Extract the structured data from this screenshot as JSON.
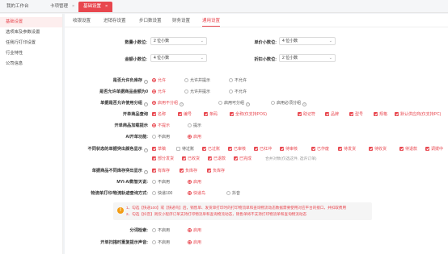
{
  "top_tabs": [
    {
      "label": "我的工作台",
      "closable": false
    },
    {
      "label": "卡项管理",
      "closable": true
    },
    {
      "label": "基础设置",
      "closable": true,
      "active": true
    }
  ],
  "sidebar": {
    "items": [
      {
        "label": "基础设置",
        "active": true
      },
      {
        "label": "选项库及参数设置"
      },
      {
        "label": "任我行打印设置"
      },
      {
        "label": "行业特性"
      },
      {
        "label": "公司信息"
      }
    ]
  },
  "subtabs": [
    {
      "label": "收银设置"
    },
    {
      "label": "进销存设置"
    },
    {
      "label": "步口数设置"
    },
    {
      "label": "财务设置"
    },
    {
      "label": "通用设置",
      "active": true
    }
  ],
  "decimals": {
    "qty_label": "数量小数位:",
    "qty_value": "2 位小数",
    "unit_price_label": "单价小数位:",
    "unit_price_value": "4 位小数",
    "amount_label": "金额小数位:",
    "amount_value": "4 位小数",
    "discount_label": "折扣小数位:",
    "discount_value": "2 位小数"
  },
  "settings": {
    "negative_stock": {
      "label": "是否允许负库存",
      "options": [
        "允许",
        "允许并提示",
        "不允许"
      ]
    },
    "price_zero": {
      "label": "是否允许单据商品金额为0",
      "options": [
        "允许",
        "允许并提示",
        "不允许"
      ]
    },
    "multi_unit": {
      "label": "单据是否允许使用分组",
      "options": [
        "启用不分组",
        "启用可分组",
        "启用必须分组"
      ]
    },
    "goods_fields": {
      "label": "开单商品查询",
      "options": [
        "名称",
        "编号",
        "条码",
        "全称(仅支持POS)",
        "助记符",
        "品牌",
        "型号",
        "规格",
        "默认供应商(仅支持PC)"
      ]
    },
    "tip_on_open": {
      "label": "开单商品加载提示",
      "options": [
        "不提示",
        "提示"
      ]
    },
    "ai_open": {
      "label": "AI开单功能:",
      "options": [
        "不启用",
        "启用"
      ]
    },
    "bill_status": {
      "label": "不同状态的单据突出颜色显示",
      "row1": [
        "草稿",
        "待过账",
        "已过账",
        "已审核",
        "已红冲",
        "待审核",
        "已作废",
        "待发货",
        "待收货",
        "待退款",
        "调拨中"
      ],
      "row2": [
        "部分发货",
        "已收货",
        "已退款",
        "已完成"
      ],
      "hint": "合并对数(仅选这件, 选许订单)"
    },
    "zero_stock": {
      "label": "单据商品不同库存突出显示",
      "options": [
        "有库存",
        "负库存",
        "负库存"
      ]
    },
    "myi_ai": {
      "label": "MYI-AI数智天说:",
      "options": [
        "不启用",
        "启用"
      ]
    },
    "logistics": {
      "label": "物流单打印/物流轨迹查询方式:",
      "options": [
        "快递100",
        "快递鸟",
        "抖音"
      ]
    },
    "note_lines": [
      "1、勾选【快递100】或【快递鸟】后，销售单、发货单打印时的打印物流单和查询物流动态数据需要使用对应平台的接口，并扣取费用",
      "2、勾选【抖音】则仅小程序订单支持打印物流单和查询物流动态，销售单将不支持打印物流单和查询物流动态"
    ],
    "sub_order": {
      "label": "分词检索:",
      "options": [
        "不启用",
        "启用"
      ]
    },
    "scan_repeat": {
      "label": "开单扫描时重复提示声音:",
      "options": [
        "不启用",
        "启用"
      ]
    }
  },
  "colors": {
    "accent": "#e8464e",
    "warning": "#f39c12"
  }
}
